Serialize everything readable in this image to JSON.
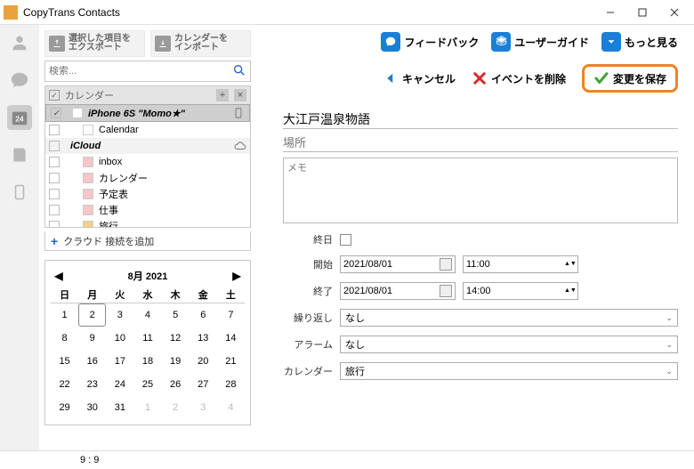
{
  "app": {
    "title": "CopyTrans Contacts"
  },
  "toolbar": {
    "export": "選択した項目を\nエクスポート",
    "import": "カレンダーを\nインポート"
  },
  "search": {
    "placeholder": "検索..."
  },
  "tree": {
    "header": "カレンダー",
    "rows": [
      {
        "label": "iPhone 6S \"Momo★\"",
        "sel": true,
        "chip": "#fff",
        "indent": 0,
        "end": "phone"
      },
      {
        "label": "Calendar",
        "indent": 1,
        "chip": "#fff"
      },
      {
        "label": "iCloud",
        "group": true,
        "indent": 0,
        "end": "cloud"
      },
      {
        "label": "inbox",
        "indent": 1,
        "chip": "#f7c5c5"
      },
      {
        "label": "カレンダー",
        "indent": 1,
        "chip": "#f7c5c5"
      },
      {
        "label": "予定表",
        "indent": 1,
        "chip": "#f7c5c5"
      },
      {
        "label": "仕事",
        "indent": 1,
        "chip": "#f7c5c5"
      },
      {
        "label": "旅行",
        "indent": 1,
        "chip": "#f5d186"
      }
    ]
  },
  "addcloud": "クラウド 接続を追加",
  "calendar": {
    "title": "8月 2021",
    "dow": [
      "日",
      "月",
      "火",
      "水",
      "木",
      "金",
      "土"
    ],
    "today": 2,
    "rows": [
      [
        1,
        2,
        3,
        4,
        5,
        6,
        7
      ],
      [
        8,
        9,
        10,
        11,
        12,
        13,
        14
      ],
      [
        15,
        16,
        17,
        18,
        19,
        20,
        21
      ],
      [
        22,
        23,
        24,
        25,
        26,
        27,
        28
      ],
      [
        29,
        30,
        31,
        1,
        2,
        3,
        4
      ]
    ]
  },
  "topbuttons": {
    "feedback": "フィードバック",
    "guide": "ユーザーガイド",
    "more": "もっと見る"
  },
  "actions": {
    "cancel": "キャンセル",
    "delete": "イベントを削除",
    "save": "変更を保存"
  },
  "form": {
    "title_value": "大江戸温泉物語",
    "location_placeholder": "場所",
    "memo_placeholder": "メモ",
    "allday_label": "終日",
    "start_label": "開始",
    "start_date": "2021/08/01",
    "start_time": "11:00",
    "end_label": "終了",
    "end_date": "2021/08/01",
    "end_time": "14:00",
    "repeat_label": "繰り返し",
    "repeat_value": "なし",
    "alarm_label": "アラーム",
    "alarm_value": "なし",
    "calendar_label": "カレンダー",
    "calendar_value": "旅行"
  },
  "status": "9 : 9"
}
